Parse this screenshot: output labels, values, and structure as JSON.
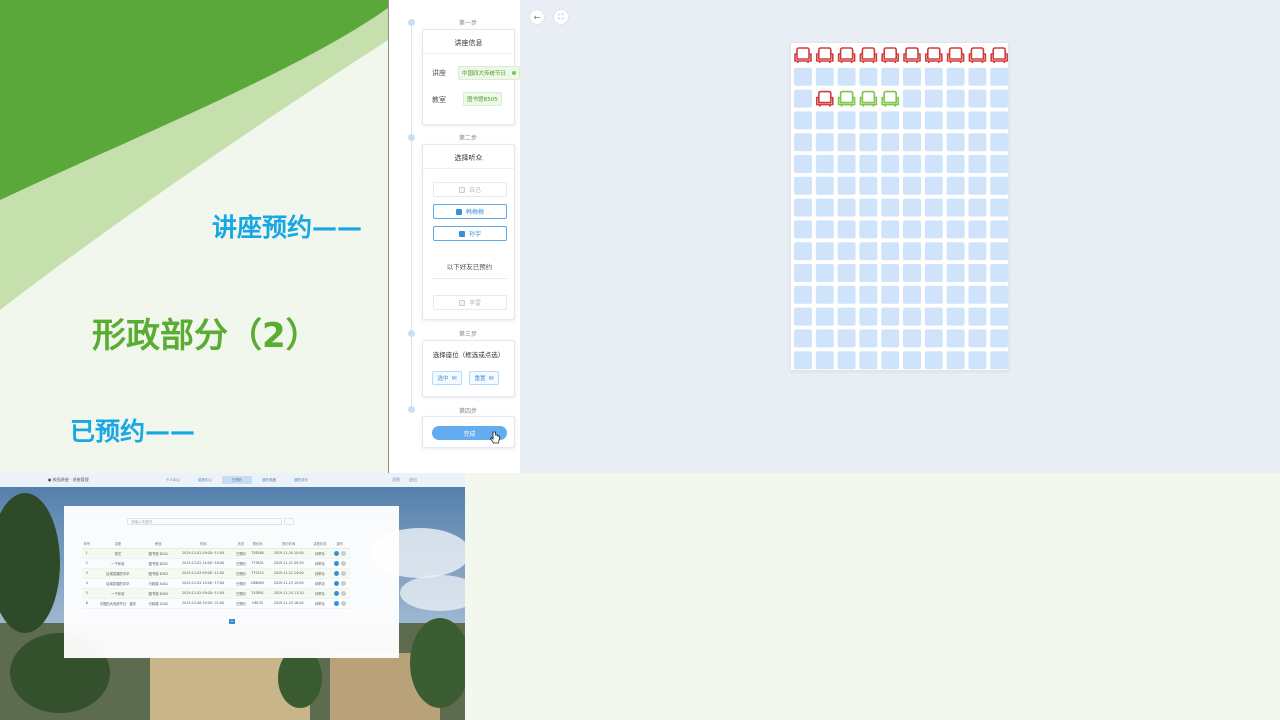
{
  "slide": {
    "lecture_label": "讲座预约——",
    "title": "形政部分（2）",
    "booked_label": "已预约——",
    "colors": {
      "green": "#5aad33",
      "blue": "#16a7e4"
    }
  },
  "steps": {
    "step1": {
      "title": "第一步",
      "card_title": "讲座信息",
      "lecture_label": "讲座",
      "lecture_value": "中国四大传统节日",
      "room_label": "教室",
      "room_value": "图书馆B505"
    },
    "step2": {
      "title": "第二步",
      "card_title": "选择听众",
      "audience": [
        {
          "name": "自己",
          "checked": false
        },
        {
          "name": "韩梅梅",
          "checked": true
        },
        {
          "name": "孙宇",
          "checked": true
        }
      ],
      "booked_note": "以下好友已预约",
      "booked_friends": [
        {
          "name": "李雷",
          "checked": false
        }
      ]
    },
    "step3": {
      "title": "第三步",
      "card_title": "选择座位（框选或点选）",
      "selected_label": "选中",
      "reset_label": "重置"
    },
    "step4": {
      "title": "第四步",
      "done_label": "完成"
    }
  },
  "toolbar": {
    "back_icon": "arrow-left-icon",
    "fullscreen_icon": "fullscreen-icon"
  },
  "seat_map": {
    "rows": 15,
    "cols": 10,
    "row1_status": "occupied",
    "row3": [
      "available",
      "occupied",
      "selected",
      "selected",
      "selected"
    ],
    "colors": {
      "available": "#cfe4fb",
      "occupied": "#d23b3b",
      "selected": "#7fc64a"
    }
  },
  "browser": {
    "site_title": "● 校园讲座 · 讲座管理",
    "nav": [
      "个人中心",
      "讲座中心",
      "已预约",
      "我的收藏",
      "我的评价"
    ],
    "active_nav": 2,
    "user_links": [
      "消息",
      "退出"
    ],
    "search_placeholder": "请输入关键词",
    "columns": [
      "序号",
      "讲座",
      "教室",
      "时间",
      "状态",
      "预约码",
      "预约时间",
      "讲座状态",
      "操作"
    ],
    "rows": [
      [
        "1",
        "茶艺",
        "图书馆 B101",
        "2019-12-01 09:00~11:00",
        "已预约",
        "T58260",
        "2019-11-20 10:00",
        "待举办"
      ],
      [
        "2",
        "一千年前",
        "图书馆 B202",
        "2019-12-02 14:00~16:00",
        "已预约",
        "T73831",
        "2019-11-21 09:30",
        "待举办"
      ],
      [
        "3",
        "区域发展的中华",
        "图书馆 B303",
        "2019-12-03 09:00~11:00",
        "已预约",
        "T72512",
        "2019-11-22 14:00",
        "待举办"
      ],
      [
        "4",
        "区域发展的中华",
        "行政楼 A401",
        "2019-12-04 15:00~17:00",
        "已预约",
        "D66905",
        "2019-11-23 15:00",
        "待举办"
      ],
      [
        "5",
        "一千年前",
        "图书馆 B505",
        "2019-12-05 09:00~11:00",
        "已预约",
        "T43891",
        "2019-11-24 11:20",
        "待举办"
      ],
      [
        "6",
        "中国四大传统节日 · 重庆",
        "行政楼 A102",
        "2019-12-06 19:00~21:00",
        "已预约",
        "H8135",
        "2019-11-25 16:00",
        "待举办"
      ]
    ],
    "page": "1"
  }
}
